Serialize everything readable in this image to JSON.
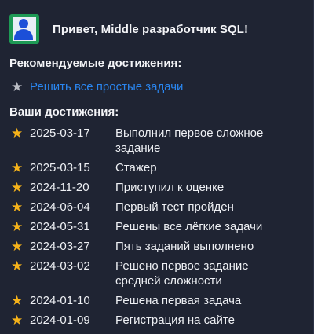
{
  "header": {
    "greeting": "Привет, Middle разработчик SQL!",
    "avatar_icon": "user-avatar-icon"
  },
  "recommended": {
    "title": "Рекомендуемые достижения:",
    "items": [
      {
        "label": "Решить все простые задачи",
        "icon": "star-gray-icon"
      }
    ]
  },
  "achievements": {
    "title": "Ваши достижения:",
    "items": [
      {
        "date": "2025-03-17",
        "label": "Выполнил первое сложное задание"
      },
      {
        "date": "2025-03-15",
        "label": "Стажер"
      },
      {
        "date": "2024-11-20",
        "label": "Приступил к оценке"
      },
      {
        "date": "2024-06-04",
        "label": "Первый тест пройден"
      },
      {
        "date": "2024-05-31",
        "label": "Решены все лёгкие задачи"
      },
      {
        "date": "2024-03-27",
        "label": "Пять заданий выполнено"
      },
      {
        "date": "2024-03-02",
        "label": "Решено первое задание средней сложности"
      },
      {
        "date": "2024-01-10",
        "label": "Решена первая задача"
      },
      {
        "date": "2024-01-09",
        "label": "Регистрация на сайте"
      }
    ]
  },
  "colors": {
    "background": "#1f2433",
    "star_earned": "#f5b21a",
    "star_pending": "#b9bcc4",
    "link": "#2a86f0",
    "avatar_bg": "#1e9a55"
  }
}
